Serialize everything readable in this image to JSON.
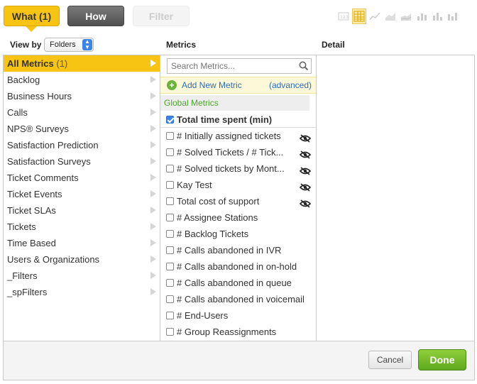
{
  "tabs": {
    "what": "What (1)",
    "how": "How",
    "filter": "Filter"
  },
  "viz_types": [
    "number-icon",
    "table-icon",
    "line-chart-icon",
    "area-chart-icon",
    "stacked-area-icon",
    "bar-chart-icon",
    "stacked-bar-icon",
    "column-chart-icon"
  ],
  "headers": {
    "view_by": "View by",
    "metrics": "Metrics",
    "detail": "Detail"
  },
  "view_by_select": {
    "value": "Folders"
  },
  "folders": [
    {
      "label": "All Metrics",
      "count": "(1)"
    },
    {
      "label": "Backlog"
    },
    {
      "label": "Business Hours"
    },
    {
      "label": "Calls"
    },
    {
      "label": "NPS® Surveys"
    },
    {
      "label": "Satisfaction Prediction"
    },
    {
      "label": "Satisfaction Surveys"
    },
    {
      "label": "Ticket Comments"
    },
    {
      "label": "Ticket Events"
    },
    {
      "label": "Ticket SLAs"
    },
    {
      "label": "Tickets"
    },
    {
      "label": "Time Based"
    },
    {
      "label": "Users & Organizations"
    },
    {
      "label": "_Filters"
    },
    {
      "label": "_spFilters"
    }
  ],
  "search": {
    "placeholder": "Search Metrics..."
  },
  "add_metric": {
    "label": "Add New Metric",
    "advanced": "(advanced)"
  },
  "global_metrics_label": "Global Metrics",
  "metrics": [
    {
      "label": "Total time spent (min)",
      "checked": true,
      "hidden": false
    },
    {
      "label": "# Initially assigned tickets",
      "checked": false,
      "hidden": true
    },
    {
      "label": "# Solved Tickets / # Tick...",
      "checked": false,
      "hidden": true
    },
    {
      "label": "# Solved tickets by Mont...",
      "checked": false,
      "hidden": true
    },
    {
      "label": "Kay Test",
      "checked": false,
      "hidden": true
    },
    {
      "label": "Total cost of support",
      "checked": false,
      "hidden": true
    },
    {
      "label": "# Assignee Stations",
      "checked": false,
      "hidden": false
    },
    {
      "label": "# Backlog Tickets",
      "checked": false,
      "hidden": false
    },
    {
      "label": "# Calls abandoned in IVR",
      "checked": false,
      "hidden": false
    },
    {
      "label": "# Calls abandoned in on-hold",
      "checked": false,
      "hidden": false
    },
    {
      "label": "# Calls abandoned in queue",
      "checked": false,
      "hidden": false
    },
    {
      "label": "# Calls abandoned in voicemail",
      "checked": false,
      "hidden": false
    },
    {
      "label": "# End-Users",
      "checked": false,
      "hidden": false
    },
    {
      "label": "# Group Reassignments",
      "checked": false,
      "hidden": false
    }
  ],
  "footer": {
    "cancel": "Cancel",
    "done": "Done"
  },
  "colors": {
    "accent_yellow": "#f7c414",
    "done_green": "#6cb33e",
    "link_blue": "#2a6ebb",
    "checkbox_blue": "#3d84e6"
  }
}
